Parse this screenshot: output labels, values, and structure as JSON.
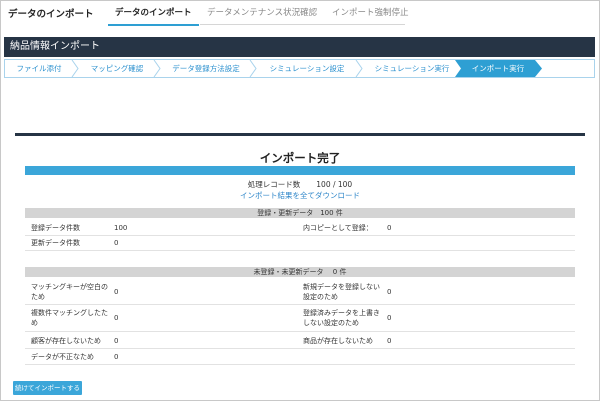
{
  "app": {
    "title": "データのインポート"
  },
  "nav": {
    "tabs": [
      {
        "label": "データのインポート"
      },
      {
        "label": "データメンテナンス状況確認"
      },
      {
        "label": "インポート強制停止"
      }
    ]
  },
  "panel": {
    "title": "納品情報インポート"
  },
  "steps": [
    {
      "label": "ファイル添付"
    },
    {
      "label": "マッピング確認"
    },
    {
      "label": "データ登録方法設定"
    },
    {
      "label": "シミュレーション設定"
    },
    {
      "label": "シミュレーション実行"
    },
    {
      "label": "インポート実行"
    }
  ],
  "result": {
    "title": "インポート完了",
    "processed_label": "処理レコード数",
    "processed_value": "100 / 100",
    "download_link": "インポート結果を全てダウンロード"
  },
  "registered": {
    "header": "登録・更新データ　100 件",
    "rows": [
      {
        "label": "登録データ件数",
        "value": "100"
      },
      {
        "label": "更新データ件数",
        "value": "0"
      }
    ],
    "right": {
      "label": "内コピーとして登録：",
      "value": "0"
    }
  },
  "unregistered": {
    "header": "未登録・未更新データ　 0 件",
    "left": [
      {
        "label": "マッチングキーが空白のため",
        "value": "0"
      },
      {
        "label": "複数件マッチングしたため",
        "value": "0"
      },
      {
        "label": "顧客が存在しないため",
        "value": "0"
      },
      {
        "label": "データが不正なため",
        "value": "0"
      }
    ],
    "right": [
      {
        "label": "新規データを登録しない設定のため",
        "value": "0"
      },
      {
        "label": "登録済みデータを上書きしない設定のため",
        "value": "0"
      },
      {
        "label": "商品が存在しないため",
        "value": "0"
      }
    ]
  },
  "buttons": {
    "continue": "続けてインポートする"
  },
  "colors": {
    "accent": "#3ba6d9",
    "header_dark": "#263445",
    "link": "#2e86c9"
  }
}
